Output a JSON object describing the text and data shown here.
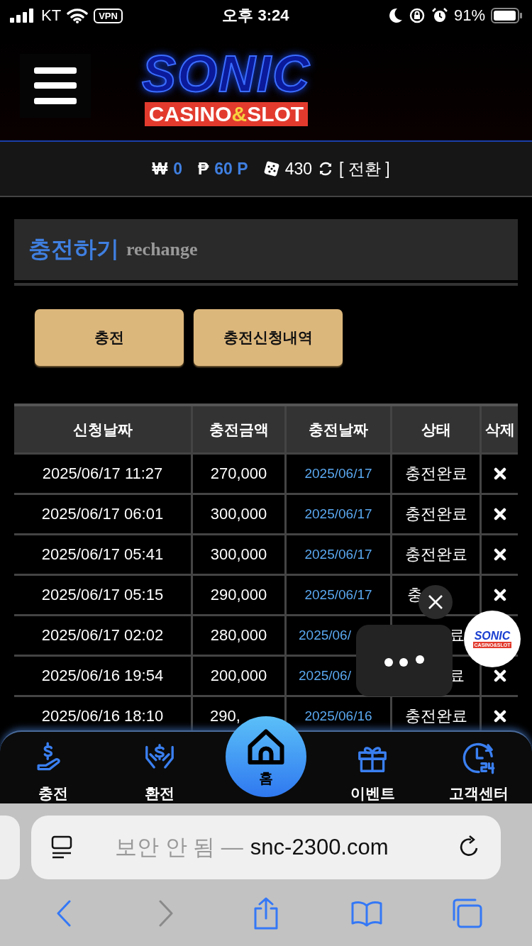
{
  "status_bar": {
    "carrier": "KT",
    "vpn": "VPN",
    "time": "오후 3:24",
    "battery": "91%"
  },
  "logo": {
    "title": "SONIC",
    "subtitle": [
      "CASINO",
      "&",
      "SLOT"
    ]
  },
  "balance": {
    "won_sign": "₩",
    "won": "0",
    "point_sign": "₱",
    "points": "60 P",
    "chips": "430",
    "convert": "[ 전환 ]"
  },
  "section": {
    "title": "충전하기",
    "subtitle": "rechange"
  },
  "buttons": [
    "충전",
    "충전신청내역"
  ],
  "table": {
    "columns": [
      "신청날짜",
      "충전금액",
      "충전날짜",
      "상태",
      "삭제"
    ],
    "rows": [
      {
        "kind": "plain",
        "requested": "2025/06/17 11:27",
        "amount": "270,000",
        "charged": "2025/06/17",
        "status": "충전완료"
      },
      {
        "kind": "plain",
        "requested": "2025/06/17 06:01",
        "amount": "300,000",
        "charged": "2025/06/17",
        "status": "충전완료"
      },
      {
        "kind": "plain",
        "requested": "2025/06/17 05:41",
        "amount": "300,000",
        "charged": "2025/06/17",
        "status": "충전완료"
      },
      {
        "kind": "statuscut",
        "requested": "2025/06/17 05:15",
        "amount": "290,000",
        "charged": "2025/06/17",
        "status": "충"
      },
      {
        "kind": "badgecut",
        "requested": "2025/06/17 02:02",
        "amount": "280,000",
        "charged": "2025/06/",
        "status": "료"
      },
      {
        "kind": "middlecut",
        "requested": "2025/06/16 19:54",
        "amount": "200,000",
        "charged": "2025/06/",
        "status": "료"
      },
      {
        "kind": "amountcut",
        "requested": "2025/06/16 18:10",
        "amount": "290,",
        "charged": "2025/06/16",
        "status": "충전완료"
      }
    ]
  },
  "chat_widget": {
    "badge_title": "SONIC",
    "badge_subtitle": "CASINO&SLOT"
  },
  "bottom_nav": [
    {
      "label": "충전",
      "kind": "tab"
    },
    {
      "label": "환전",
      "kind": "tab"
    },
    {
      "label": "홈",
      "kind": "home"
    },
    {
      "label": "이벤트",
      "kind": "tab"
    },
    {
      "label": "고객센터",
      "kind": "tab"
    }
  ],
  "browser": {
    "security": "보안 안 됨 —",
    "url": "snc-2300.com",
    "toolbar": [
      {
        "kind": "back",
        "disabled": false
      },
      {
        "kind": "forward",
        "disabled": true
      },
      {
        "kind": "share",
        "disabled": false
      },
      {
        "kind": "bookmarks",
        "disabled": false
      },
      {
        "kind": "tabs",
        "disabled": false
      }
    ]
  }
}
